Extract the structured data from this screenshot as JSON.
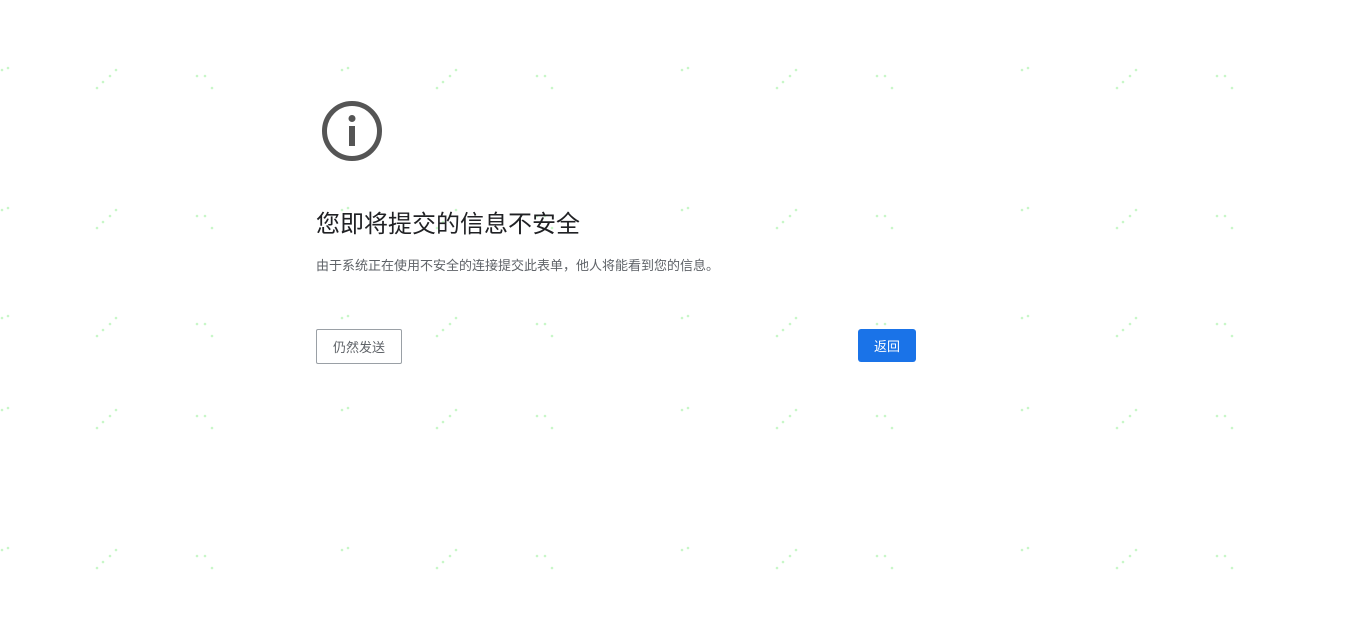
{
  "interstitial": {
    "heading": "您即将提交的信息不安全",
    "message": "由于系统正在使用不安全的连接提交此表单，他人将能看到您的信息。",
    "send_anyway_label": "仍然发送",
    "back_label": "返回",
    "icon": "info-icon"
  },
  "colors": {
    "primary_button": "#1a73e8",
    "icon": "#5f6368",
    "heading": "#202124",
    "body_text": "#5f6368"
  }
}
